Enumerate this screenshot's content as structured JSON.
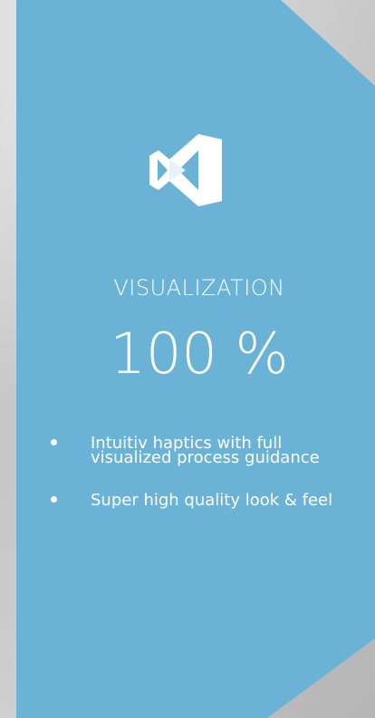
{
  "colors": {
    "panel": "#6ab3d7",
    "background": "#cfcfcf",
    "text": "#ffffff"
  },
  "logo": {
    "icon": "visual-studio-style-logo-icon"
  },
  "title": "VISUALIZATION",
  "value": "100 %",
  "bullets": [
    {
      "text": "Intuitiv haptics with full visualized process guidance"
    },
    {
      "text": "Super high quality look & feel"
    }
  ]
}
